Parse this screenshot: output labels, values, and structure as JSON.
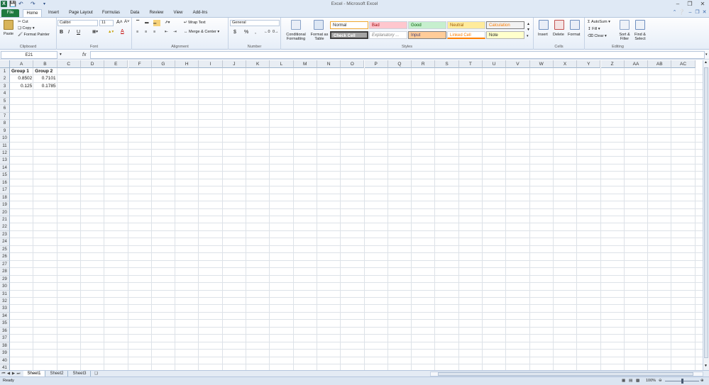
{
  "title_bar": {
    "title": "Excel - Microsoft Excel"
  },
  "tabs": [
    "File",
    "Home",
    "Insert",
    "Page Layout",
    "Formulas",
    "Data",
    "Review",
    "View",
    "Add-Ins"
  ],
  "clipboard": {
    "paste": "Paste",
    "cut": "Cut",
    "copy": "Copy",
    "format_painter": "Format Painter",
    "label": "Clipboard"
  },
  "font": {
    "name": "Calibri",
    "size": "11",
    "bold": "B",
    "italic": "I",
    "underline": "U",
    "label": "Font"
  },
  "alignment": {
    "wrap_text": "Wrap Text",
    "merge_center": "Merge & Center",
    "label": "Alignment"
  },
  "number": {
    "format": "General",
    "currency": "$",
    "percent": "%",
    "comma": ",",
    "label": "Number"
  },
  "styles": {
    "conditional_formatting": "Conditional Formatting",
    "format_as_table": "Format as Table",
    "normal": "Normal",
    "bad": "Bad",
    "good": "Good",
    "neutral": "Neutral",
    "calculation": "Calculation",
    "check_cell": "Check Cell",
    "explanatory": "Explanatory ...",
    "input": "Input",
    "linked_cell": "Linked Cell",
    "note": "Note",
    "label": "Styles"
  },
  "cells_group": {
    "insert": "Insert",
    "delete": "Delete",
    "format": "Format",
    "label": "Cells"
  },
  "editing": {
    "autosum": "AutoSum",
    "fill": "Fill",
    "clear": "Clear",
    "sort_filter": "Sort & Filter",
    "find_select": "Find & Select",
    "label": "Editing"
  },
  "formula_bar": {
    "name_box": "E21",
    "fx": "fx",
    "formula": ""
  },
  "columns": [
    "A",
    "B",
    "C",
    "D",
    "E",
    "F",
    "G",
    "H",
    "I",
    "J",
    "K",
    "L",
    "M",
    "N",
    "O",
    "P",
    "Q",
    "R",
    "S",
    "T",
    "U",
    "V",
    "W",
    "X",
    "Y",
    "Z",
    "AA",
    "AB",
    "AC"
  ],
  "rows": [
    "1",
    "2",
    "3",
    "4",
    "5",
    "6",
    "7",
    "8",
    "9",
    "10",
    "11",
    "12",
    "13",
    "14",
    "15",
    "16",
    "17",
    "18",
    "19",
    "20",
    "21",
    "22",
    "23",
    "24",
    "25",
    "26",
    "27",
    "28",
    "29",
    "30",
    "31",
    "32",
    "33",
    "34",
    "35",
    "36",
    "37",
    "38",
    "39",
    "40",
    "41"
  ],
  "cells": {
    "A1": "Group 1",
    "B1": "Group 2",
    "A2": "0.8502",
    "B2": "0.7101",
    "A3": "0.125",
    "B3": "0.1785"
  },
  "sheets": [
    "Sheet1",
    "Sheet2",
    "Sheet3"
  ],
  "status": {
    "ready": "Ready",
    "zoom": "100%"
  }
}
